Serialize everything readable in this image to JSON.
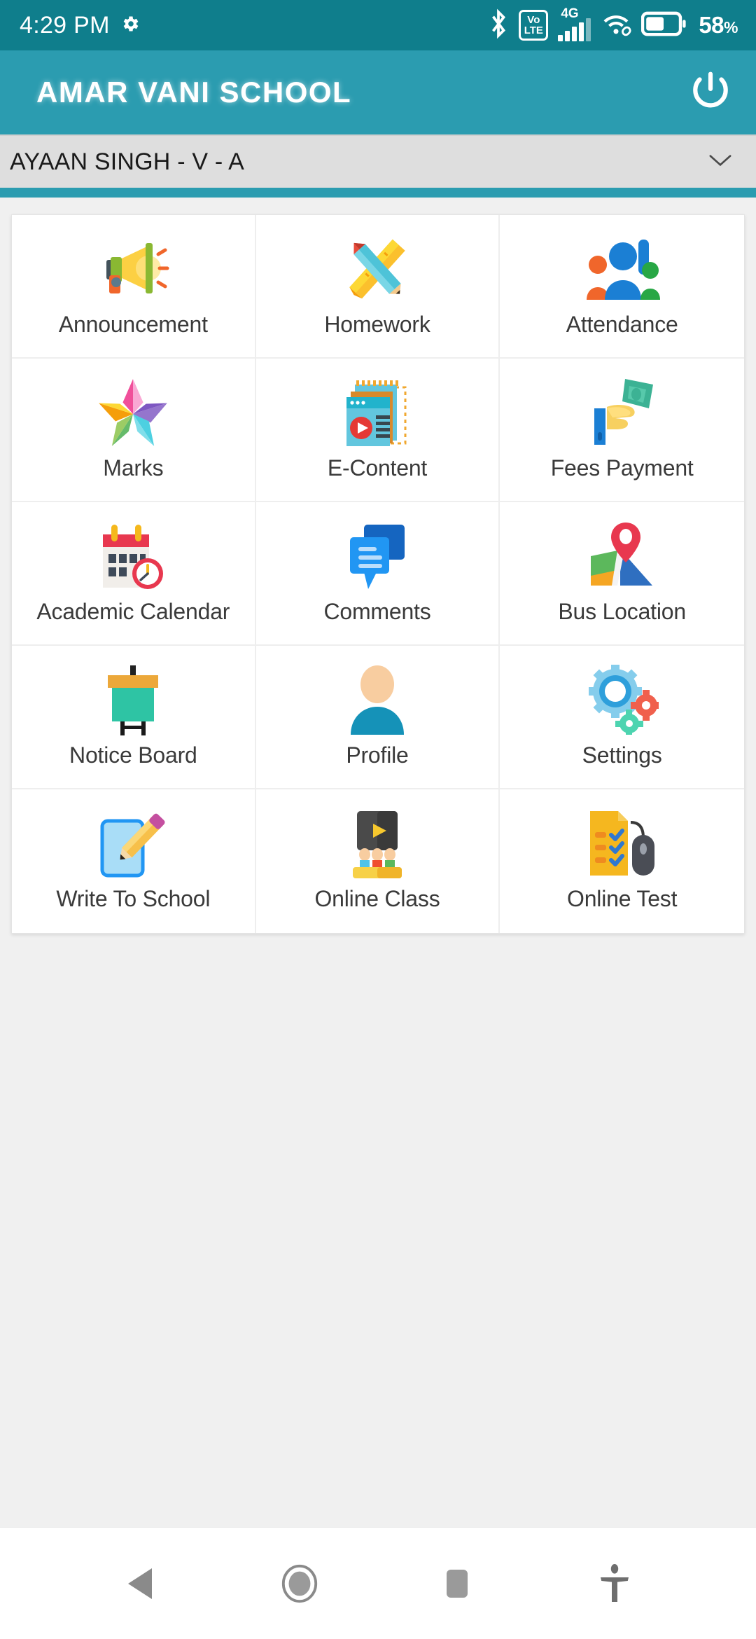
{
  "status_bar": {
    "time": "4:29 PM",
    "gear_icon": "gear-icon",
    "bluetooth_icon": "bluetooth-icon",
    "volte_top": "Vo",
    "volte_bottom": "LTE",
    "network_type": "4G",
    "signal_icon": "cellular-signal-icon",
    "wifi_icon": "wifi-icon",
    "battery_icon": "battery-icon",
    "battery_level": "58",
    "battery_unit": "%"
  },
  "app_bar": {
    "title": "AMAR VANI SCHOOL",
    "logout_icon": "power-icon"
  },
  "student_selector": {
    "selected": "AYAAN SINGH - V - A",
    "chevron_icon": "chevron-down-icon"
  },
  "grid": {
    "tiles": [
      {
        "label": "Announcement",
        "icon": "megaphone-icon"
      },
      {
        "label": "Homework",
        "icon": "pencil-ruler-icon"
      },
      {
        "label": "Attendance",
        "icon": "people-raised-hand-icon"
      },
      {
        "label": "Marks",
        "icon": "star-icon"
      },
      {
        "label": "E-Content",
        "icon": "media-documents-icon"
      },
      {
        "label": "Fees Payment",
        "icon": "hand-money-icon"
      },
      {
        "label": "Academic Calendar",
        "icon": "calendar-clock-icon"
      },
      {
        "label": "Comments",
        "icon": "speech-bubbles-icon"
      },
      {
        "label": "Bus Location",
        "icon": "map-pin-icon"
      },
      {
        "label": "Notice Board",
        "icon": "notice-board-icon"
      },
      {
        "label": "Profile",
        "icon": "person-avatar-icon"
      },
      {
        "label": "Settings",
        "icon": "gears-icon"
      },
      {
        "label": "Write To School",
        "icon": "write-pencil-icon"
      },
      {
        "label": "Online Class",
        "icon": "online-class-icon"
      },
      {
        "label": "Online Test",
        "icon": "checklist-mouse-icon"
      }
    ]
  },
  "nav_bar": {
    "back_icon": "back-triangle-icon",
    "home_icon": "home-circle-icon",
    "recents_icon": "recents-square-icon",
    "accessibility_icon": "accessibility-icon"
  },
  "colors": {
    "status_bar_bg": "#0f7e8c",
    "app_bar_bg": "#2b9cb0",
    "selector_bg": "#dedede",
    "page_bg": "#f0f0f0",
    "tile_bg": "#ffffff",
    "label_text": "#3a3a3a"
  }
}
